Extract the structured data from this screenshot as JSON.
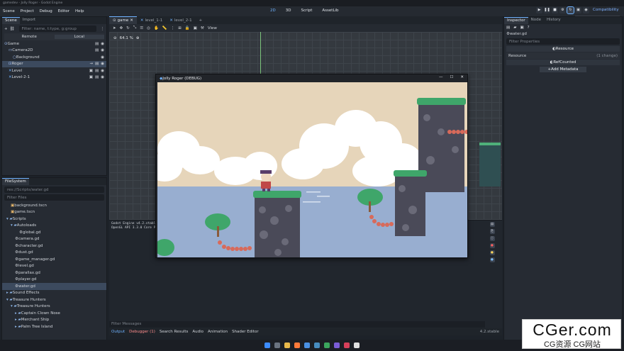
{
  "window_title": "gamedev - Jolly Roger - Godot Engine",
  "menu": [
    "Scene",
    "Project",
    "Debug",
    "Editor",
    "Help"
  ],
  "workspaces": [
    "2D",
    "3D",
    "Script",
    "AssetLib"
  ],
  "renderer": "Compatibility",
  "tooltip": [
    "Run Current Scene (F6)",
    "Reload the played scene."
  ],
  "scene_dock": {
    "tabs": [
      "Scene",
      "Import"
    ],
    "filter_placeholder": "Filter: name, t:type, g:group",
    "remote": "Remote",
    "local": "Local",
    "tree": [
      "Game",
      "Camera2D",
      "Background",
      "Roger",
      "Level",
      "Level-2-1"
    ]
  },
  "filesystem": {
    "tab": "FileSystem",
    "path": "res://Scripts/water.gd",
    "filter_placeholder": "Filter Files",
    "items": [
      "background.tscn",
      "game.tscn",
      "Scripts",
      "Autoloads",
      "global.gd",
      "camera.gd",
      "character.gd",
      "dust.gd",
      "game_manager.gd",
      "level.gd",
      "parallax.gd",
      "player.gd",
      "water.gd",
      "Sound Effects",
      "Treasure Hunters",
      "Treasure Hunters",
      "Captain Clown Nose",
      "Merchant Ship",
      "Palm Tree Island"
    ]
  },
  "editor_tabs": [
    "game",
    "level_1-1",
    "level_2-1"
  ],
  "toolbar_view": "View",
  "zoom": "64.1 %",
  "game_window_title": "Jolly Roger (DEBUG)",
  "output_lines": [
    "Godot Engine v4.2.stable",
    "OpenGL API 3.3.0 Core P"
  ],
  "output_filter": "Filter Messages",
  "bottom_tabs": [
    "Output",
    "Debugger (1)",
    "Search Results",
    "Audio",
    "Animation",
    "Shader Editor"
  ],
  "version": "4.2.stable",
  "inspector": {
    "tabs": [
      "Inspector",
      "Node",
      "History"
    ],
    "file": "water.gd",
    "filter": "Filter Properties",
    "sections": [
      "Resource",
      "Resource",
      "RefCounted"
    ],
    "changes": "(1 change)",
    "add_metadata": "Add Metadata"
  },
  "watermark": {
    "top": "CGer.com",
    "bottom": "CG资源 CG网站"
  }
}
